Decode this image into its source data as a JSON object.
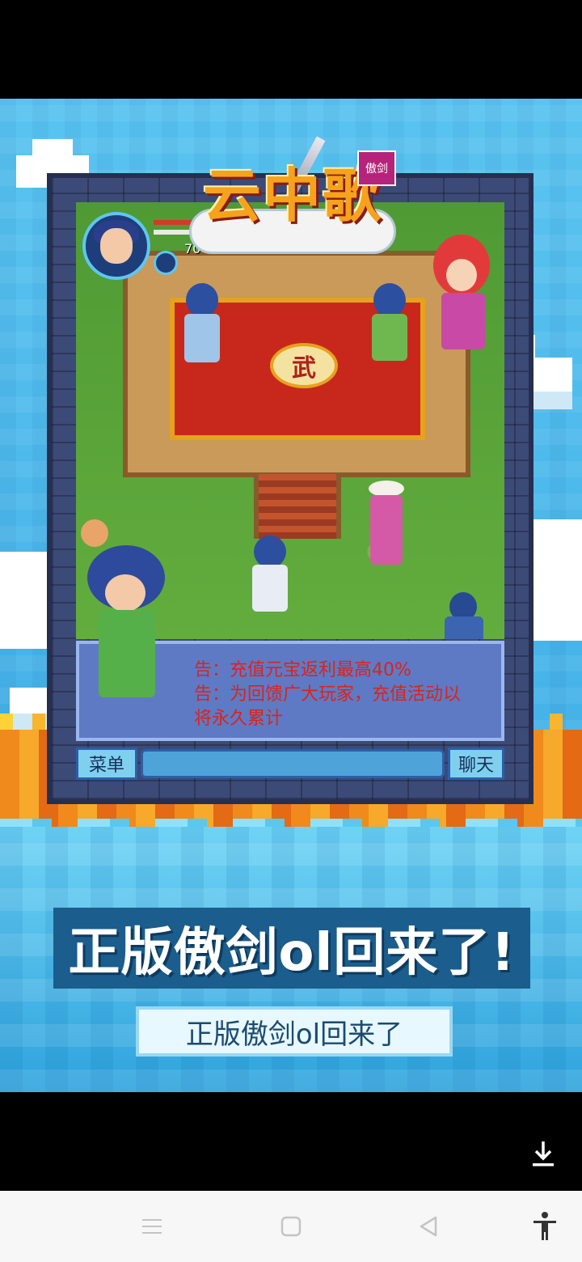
{
  "game": {
    "logo_text": "云中歌",
    "logo_seal": "傲剑",
    "emblem": "武",
    "level": "70",
    "chat_lines": [
      "告：充值元宝返利最高40%",
      "告：为回馈广大玩家，充值活动以",
      "将永久累计"
    ],
    "menu_label": "菜单",
    "chat_label": "聊天",
    "hp_fraction": 1.0,
    "mp_fraction": 1.0
  },
  "poster": {
    "headline": "正版傲剑ol回来了!",
    "subline": "正版傲剑ol回来了"
  },
  "icons": {
    "download": "download-icon",
    "nav_menu": "menu-icon",
    "nav_home": "home-square-icon",
    "nav_back": "back-triangle-icon",
    "nav_accessibility": "accessibility-icon"
  },
  "colors": {
    "sky": "#48b4e8",
    "fire": "#f08a1c",
    "headline_bg": "#1b5d8c",
    "chat_text": "#d8241c"
  }
}
